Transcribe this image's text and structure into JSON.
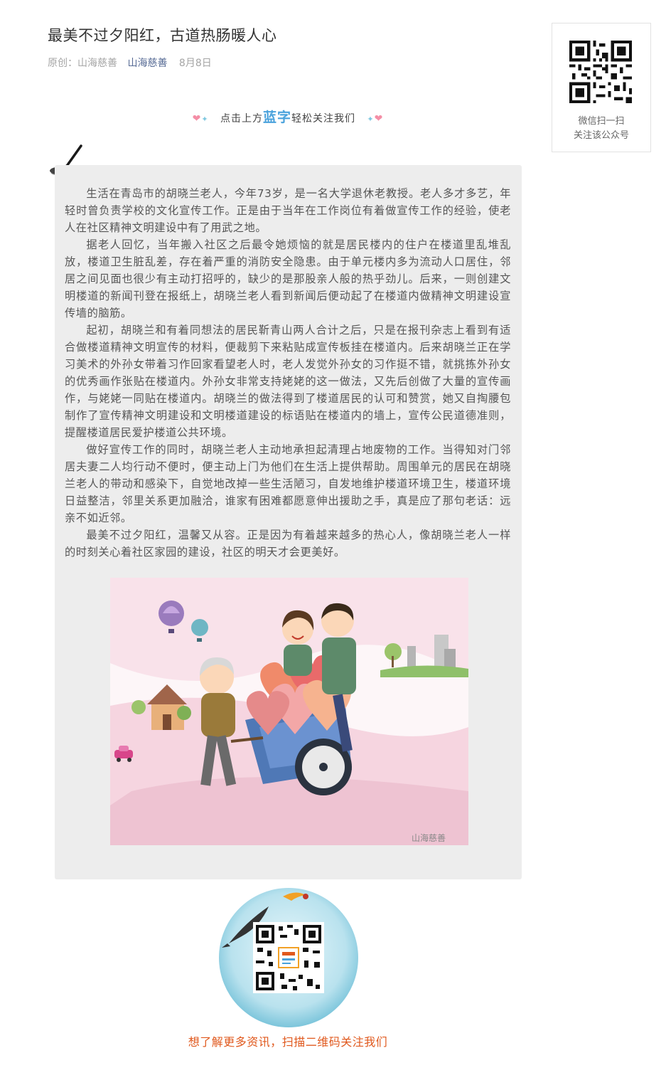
{
  "article": {
    "title": "最美不过夕阳红，古道热肠暖人心",
    "meta": {
      "original_label": "原创：山海慈善",
      "account": "山海慈善",
      "date": "8月8日"
    }
  },
  "qr_side": {
    "line1": "微信扫一扫",
    "line2": "关注该公众号"
  },
  "follow_banner": {
    "pre": "点击上方",
    "highlight": "蓝字",
    "post": "轻松关注我们"
  },
  "body": {
    "paragraphs": [
      "生活在青岛市的胡晓兰老人，今年73岁，是一名大学退休老教授。老人多才多艺，年轻时曾负责学校的文化宣传工作。正是由于当年在工作岗位有着做宣传工作的经验，使老人在社区精神文明建设中有了用武之地。",
      "据老人回忆，当年搬入社区之后最令她烦恼的就是居民楼内的住户在楼道里乱堆乱放，楼道卫生脏乱差，存在着严重的消防安全隐患。由于单元楼内多为流动人口居住，邻居之间见面也很少有主动打招呼的，缺少的是那股亲人般的热乎劲儿。后来，一则创建文明楼道的新闻刊登在报纸上，胡晓兰老人看到新闻后便动起了在楼道内做精神文明建设宣传墙的脑筋。",
      "起初，胡晓兰和有着同想法的居民靳青山两人合计之后，只是在报刊杂志上看到有适合做楼道精神文明宣传的材料，便裁剪下来粘贴成宣传板挂在楼道内。后来胡晓兰正在学习美术的外孙女带着习作回家看望老人时，老人发觉外孙女的习作挺不错，就挑拣外孙女的优秀画作张贴在楼道内。外孙女非常支持姥姥的这一做法，又先后创做了大量的宣传画作，与姥姥一同贴在楼道内。胡晓兰的做法得到了楼道居民的认可和赞赏，她又自掏腰包制作了宣传精神文明建设和文明楼道建设的标语贴在楼道内的墙上，宣传公民道德准则，提醒楼道居民爱护楼道公共环境。",
      "做好宣传工作的同时，胡晓兰老人主动地承担起清理占地废物的工作。当得知对门邻居夫妻二人均行动不便时，便主动上门为他们在生活上提供帮助。周围单元的居民在胡晓兰老人的带动和感染下，自觉地改掉一些生活陋习，自发地维护楼道环境卫生，楼道环境日益整洁，邻里关系更加融洽，谁家有困难都愿意伸出援助之手，真是应了那句老话：远亲不如近邻。",
      "最美不过夕阳红，温馨又从容。正是因为有着越来越多的热心人，像胡晓兰老人一样的时刻关心着社区家园的建设，社区的明天才会更美好。"
    ]
  },
  "illustration": {
    "watermark": "山海慈善"
  },
  "footer": {
    "text": "想了解更多资讯，扫描二维码关注我们"
  },
  "icons": [
    "qr-code-icon",
    "brush-icon",
    "heart-deco-icon",
    "fish-icon",
    "bird-icon"
  ],
  "colors": {
    "link": "#576b95",
    "meta": "#a5a5a5",
    "highlight": "#4aa2dc",
    "footer": "#e0591e",
    "card": "#ededed"
  }
}
